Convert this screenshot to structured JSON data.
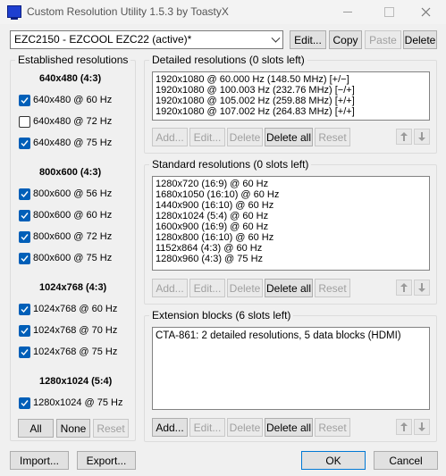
{
  "window": {
    "title": "Custom Resolution Utility 1.5.3 by ToastyX"
  },
  "monitor_select": {
    "value": "EZC2150 - EZCOOL EZC22 (active)*"
  },
  "top_buttons": {
    "edit": "Edit...",
    "copy": "Copy",
    "paste": "Paste",
    "delete": "Delete"
  },
  "established": {
    "title": "Established resolutions",
    "groups": [
      {
        "heading": "640x480 (4:3)",
        "items": [
          {
            "label": "640x480 @ 60 Hz",
            "checked": true
          },
          {
            "label": "640x480 @ 72 Hz",
            "checked": false
          },
          {
            "label": "640x480 @ 75 Hz",
            "checked": true
          }
        ]
      },
      {
        "heading": "800x600 (4:3)",
        "items": [
          {
            "label": "800x600 @ 56 Hz",
            "checked": true
          },
          {
            "label": "800x600 @ 60 Hz",
            "checked": true
          },
          {
            "label": "800x600 @ 72 Hz",
            "checked": true
          },
          {
            "label": "800x600 @ 75 Hz",
            "checked": true
          }
        ]
      },
      {
        "heading": "1024x768 (4:3)",
        "items": [
          {
            "label": "1024x768 @ 60 Hz",
            "checked": true
          },
          {
            "label": "1024x768 @ 70 Hz",
            "checked": true
          },
          {
            "label": "1024x768 @ 75 Hz",
            "checked": true
          }
        ]
      },
      {
        "heading": "1280x1024 (5:4)",
        "items": [
          {
            "label": "1280x1024 @ 75 Hz",
            "checked": true
          }
        ]
      }
    ],
    "buttons": {
      "all": "All",
      "none": "None",
      "reset": "Reset"
    }
  },
  "detailed": {
    "title": "Detailed resolutions (0 slots left)",
    "items": [
      "1920x1080 @ 60.000 Hz (148.50 MHz) [+/−]",
      "1920x1080 @ 100.003 Hz (232.76 MHz) [−/+]",
      "1920x1080 @ 105.002 Hz (259.88 MHz) [+/+]",
      "1920x1080 @ 107.002 Hz (264.83 MHz) [+/+]"
    ],
    "buttons": {
      "add": "Add...",
      "edit": "Edit...",
      "delete": "Delete",
      "delete_all": "Delete all",
      "reset": "Reset"
    }
  },
  "standard": {
    "title": "Standard resolutions (0 slots left)",
    "items": [
      "1280x720 (16:9) @ 60 Hz",
      "1680x1050 (16:10) @ 60 Hz",
      "1440x900 (16:10) @ 60 Hz",
      "1280x1024 (5:4) @ 60 Hz",
      "1600x900 (16:9) @ 60 Hz",
      "1280x800 (16:10) @ 60 Hz",
      "1152x864 (4:3) @ 60 Hz",
      "1280x960 (4:3) @ 75 Hz"
    ],
    "buttons": {
      "add": "Add...",
      "edit": "Edit...",
      "delete": "Delete",
      "delete_all": "Delete all",
      "reset": "Reset"
    }
  },
  "extension": {
    "title": "Extension blocks (6 slots left)",
    "items": [
      "CTA-861: 2 detailed resolutions, 5 data blocks (HDMI)"
    ],
    "buttons": {
      "add": "Add...",
      "edit": "Edit...",
      "delete": "Delete",
      "delete_all": "Delete all",
      "reset": "Reset"
    }
  },
  "bottom_buttons": {
    "import": "Import...",
    "export": "Export...",
    "ok": "OK",
    "cancel": "Cancel"
  }
}
